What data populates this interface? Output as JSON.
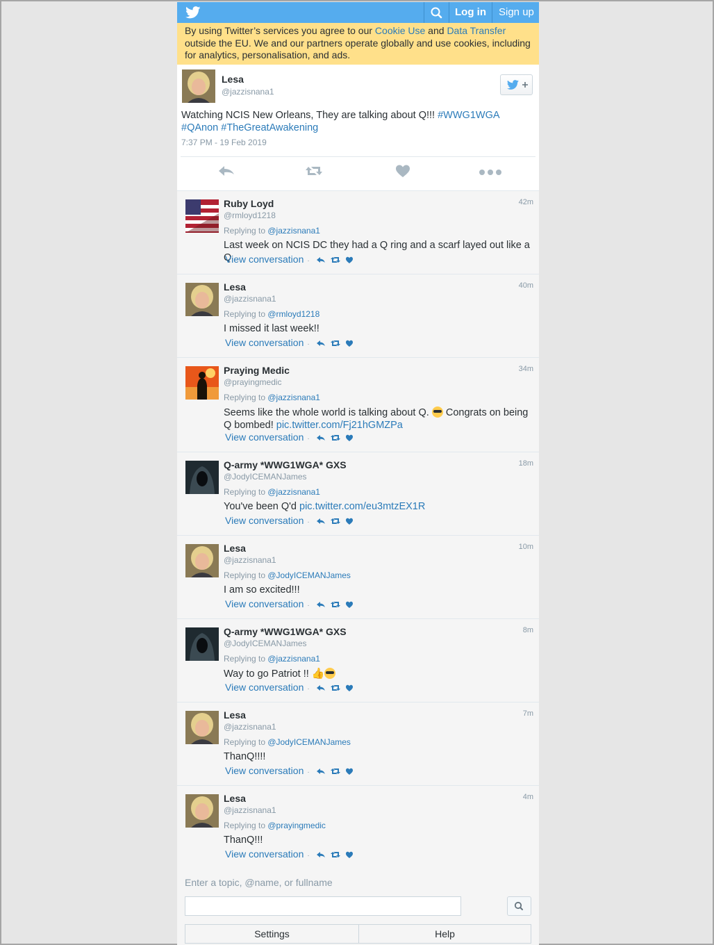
{
  "nav": {
    "login": "Log in",
    "signup": "Sign up"
  },
  "cookie": {
    "part1": "By using Twitter’s services you agree to our ",
    "cookie_link": "Cookie Use",
    "part2": " and ",
    "transfer_link": "Data Transfer",
    "part3": " outside the EU. We and our partners operate globally and use cookies, including for analytics, personalisation, and ads."
  },
  "tweet": {
    "name": "Lesa",
    "handle": "@jazzisnana1",
    "text": "Watching NCIS New Orleans, They are talking about Q!!! ",
    "hashtags": [
      "#WWG1WGA",
      "#QAnon",
      "#TheGreatAwakening"
    ],
    "time": "7:37 PM - 19 Feb 2019"
  },
  "replies": [
    {
      "name": "Ruby Loyd",
      "handle": "@rmloyd1218",
      "time": "42m",
      "replying_label": "Replying to ",
      "replying_to": "@jazzisnana1",
      "text": "Last week on NCIS DC they had a Q ring and a scarf layed out like a Q",
      "avatar": "flag",
      "view": "View conversation"
    },
    {
      "name": "Lesa",
      "handle": "@jazzisnana1",
      "time": "40m",
      "replying_label": "Replying to ",
      "replying_to": "@rmloyd1218",
      "text": "I missed it last week!!",
      "avatar": "lesa",
      "view": "View conversation"
    },
    {
      "name": "Praying Medic",
      "handle": "@prayingmedic",
      "time": "34m",
      "replying_label": "Replying to ",
      "replying_to": "@jazzisnana1",
      "text": "Seems like the whole world is talking about Q. ",
      "text2": " Congrats on being Q bombed! ",
      "link": "pic.twitter.com/Fj21hGMZPa",
      "avatar": "medic",
      "view": "View conversation"
    },
    {
      "name": "Q-army *WWG1WGA* GXS",
      "handle": "@JodyICEMANJames",
      "time": "18m",
      "replying_label": "Replying to ",
      "replying_to": "@jazzisnana1",
      "text": "You've been Q'd ",
      "link": "pic.twitter.com/eu3mtzEX1R",
      "avatar": "hood",
      "view": "View conversation"
    },
    {
      "name": "Lesa",
      "handle": "@jazzisnana1",
      "time": "10m",
      "replying_label": "Replying to ",
      "replying_to": "@JodyICEMANJames",
      "text": "I am so excited!!!",
      "avatar": "lesa",
      "view": "View conversation"
    },
    {
      "name": "Q-army *WWG1WGA* GXS",
      "handle": "@JodyICEMANJames",
      "time": "8m",
      "replying_label": "Replying to ",
      "replying_to": "@jazzisnana1",
      "text": "Way to go Patriot !! ",
      "avatar": "hood",
      "view": "View conversation"
    },
    {
      "name": "Lesa",
      "handle": "@jazzisnana1",
      "time": "7m",
      "replying_label": "Replying to ",
      "replying_to": "@JodyICEMANJames",
      "text": "ThanQ!!!!",
      "avatar": "lesa",
      "view": "View conversation"
    },
    {
      "name": "Lesa",
      "handle": "@jazzisnana1",
      "time": "4m",
      "replying_label": "Replying to ",
      "replying_to": "@prayingmedic",
      "text": "ThanQ!!!",
      "avatar": "lesa",
      "view": "View conversation"
    }
  ],
  "search": {
    "hint": "Enter a topic, @name, or fullname",
    "value": ""
  },
  "footer": {
    "settings": "Settings",
    "help": "Help"
  },
  "colors": {
    "brand": "#55acee",
    "link": "#2b7bb9",
    "cookie_bg": "#ffe08a"
  }
}
